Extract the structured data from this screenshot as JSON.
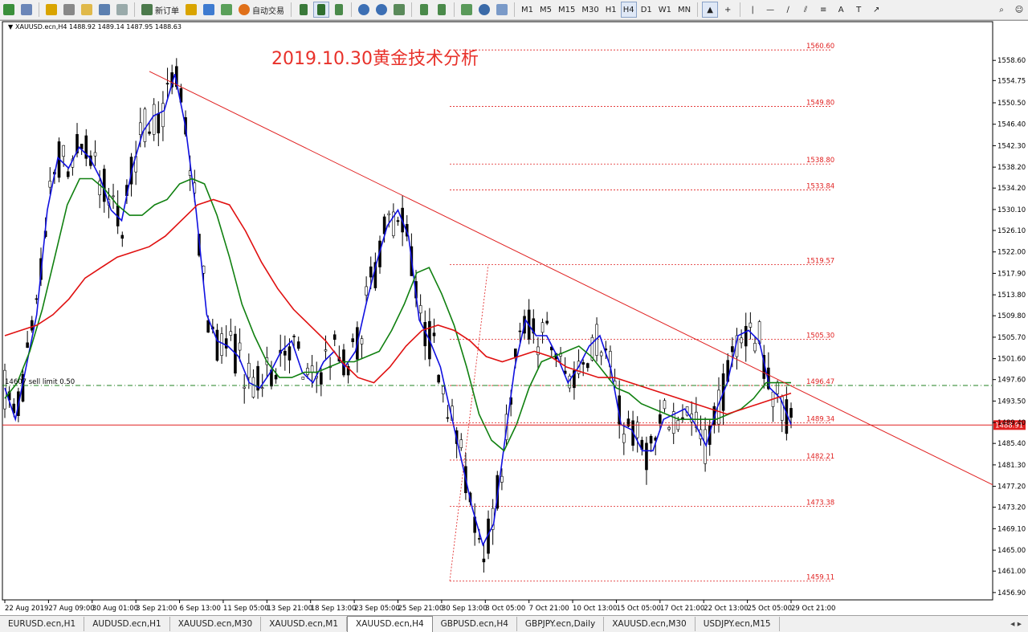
{
  "toolbar": {
    "new_order_label": "新订单",
    "autotrade_label": "自动交易",
    "timeframes": [
      "M1",
      "M5",
      "M15",
      "M30",
      "H1",
      "H4",
      "D1",
      "W1",
      "MN"
    ],
    "active_timeframe": "H4"
  },
  "chart_header": {
    "symbol_info": "XAUUSD.ecn,H4  1488.92 1489.14 1487.95 1488.63",
    "annotation_title": "2019.10.30黄金技术分析",
    "order_label": "14607 sell limit 0.50",
    "current_price": "1488.91"
  },
  "tabs": [
    {
      "label": "EURUSD.ecn,H1",
      "active": false
    },
    {
      "label": "AUDUSD.ecn,H1",
      "active": false
    },
    {
      "label": "XAUUSD.ecn,M30",
      "active": false
    },
    {
      "label": "XAUUSD.ecn,M1",
      "active": false
    },
    {
      "label": "XAUUSD.ecn,H4",
      "active": true
    },
    {
      "label": "GBPUSD.ecn,H4",
      "active": false
    },
    {
      "label": "GBPJPY.ecn,Daily",
      "active": false
    },
    {
      "label": "XAUUSD.ecn,M30",
      "active": false
    },
    {
      "label": "USDJPY.ecn,M15",
      "active": false
    }
  ],
  "chart_data": {
    "type": "line",
    "symbol": "XAUUSD.ecn",
    "timeframe": "H4",
    "ylim": [
      1455.5,
      1566.0
    ],
    "y_ticks": [
      "1558.60",
      "1554.75",
      "1550.50",
      "1546.40",
      "1542.30",
      "1538.20",
      "1534.20",
      "1530.10",
      "1526.10",
      "1522.00",
      "1517.90",
      "1513.80",
      "1509.80",
      "1505.70",
      "1501.60",
      "1497.60",
      "1493.50",
      "1489.40",
      "1485.40",
      "1481.30",
      "1477.20",
      "1473.20",
      "1469.10",
      "1465.00",
      "1461.00",
      "1456.90"
    ],
    "x_ticks": [
      "22 Aug 2019",
      "27 Aug 09:00",
      "30 Aug 01:00",
      "3 Sep 21:00",
      "6 Sep 13:00",
      "11 Sep 05:00",
      "13 Sep 21:00",
      "18 Sep 13:00",
      "23 Sep 05:00",
      "25 Sep 21:00",
      "30 Sep 13:00",
      "3 Oct 05:00",
      "7 Oct 21:00",
      "10 Oct 13:00",
      "15 Oct 05:00",
      "17 Oct 21:00",
      "22 Oct 13:00",
      "25 Oct 05:00",
      "29 Oct 21:00"
    ],
    "fib_levels": [
      "1560.60",
      "1549.80",
      "1538.80",
      "1533.84",
      "1519.57",
      "1505.30",
      "1496.47",
      "1489.34",
      "1482.21",
      "1473.38",
      "1459.11"
    ],
    "current_price": 1488.91,
    "pending_order": {
      "label": "14607 sell limit 0.50",
      "price": 1496.47
    },
    "trendline": {
      "from": {
        "x": "4 Sep 2019",
        "price": 1556.5
      },
      "to": {
        "x": "31 Oct 2019",
        "price": 1477.5
      }
    },
    "series": [
      {
        "name": "",
        "color": "#1010e0",
        "values": [
          1496,
          1490,
          1500,
          1510,
          1530,
          1540,
          1538,
          1542,
          1540,
          1536,
          1530,
          1528,
          1538,
          1545,
          1548,
          1549,
          1556,
          1546,
          1530,
          1510,
          1505,
          1504,
          1502,
          1497,
          1496,
          1499,
          1503,
          1505,
          1499,
          1497,
          1501,
          1503,
          1500,
          1503,
          1512,
          1520,
          1527,
          1530,
          1525,
          1509,
          1505,
          1500,
          1491,
          1482,
          1473,
          1466,
          1470,
          1485,
          1500,
          1509,
          1506,
          1506,
          1502,
          1497,
          1500,
          1504,
          1506,
          1500,
          1489,
          1488,
          1484,
          1484,
          1490,
          1491,
          1492,
          1489,
          1485,
          1492,
          1497,
          1506,
          1507,
          1505,
          1496,
          1494,
          1489
        ]
      },
      {
        "name": "",
        "color": "#108010",
        "values": [
          1494,
          1497,
          1503,
          1511,
          1521,
          1531,
          1536,
          1536,
          1534,
          1531,
          1529,
          1529,
          1531,
          1532,
          1535,
          1536,
          1535,
          1529,
          1521,
          1512,
          1506,
          1501,
          1498,
          1498,
          1499,
          1499,
          1500,
          1501,
          1501,
          1502,
          1503,
          1507,
          1512,
          1518,
          1519,
          1514,
          1508,
          1500,
          1491,
          1486,
          1484,
          1489,
          1496,
          1501,
          1502,
          1503,
          1504,
          1502,
          1499,
          1496,
          1495,
          1493,
          1492,
          1491,
          1490,
          1490,
          1490,
          1490,
          1491,
          1492,
          1494,
          1497,
          1497,
          1497
        ]
      },
      {
        "name": "",
        "color": "#e01010",
        "values": [
          1506,
          1507,
          1508,
          1510,
          1513,
          1517,
          1519,
          1521,
          1522,
          1523,
          1525,
          1528,
          1531,
          1532,
          1531,
          1526,
          1520,
          1515,
          1511,
          1508,
          1505,
          1501,
          1498,
          1497,
          1500,
          1504,
          1507,
          1508,
          1507,
          1505,
          1502,
          1501,
          1502,
          1503,
          1502,
          1500,
          1499,
          1498,
          1498,
          1497,
          1496,
          1495,
          1494,
          1493,
          1492,
          1491,
          1492,
          1493,
          1494,
          1495
        ]
      }
    ]
  }
}
